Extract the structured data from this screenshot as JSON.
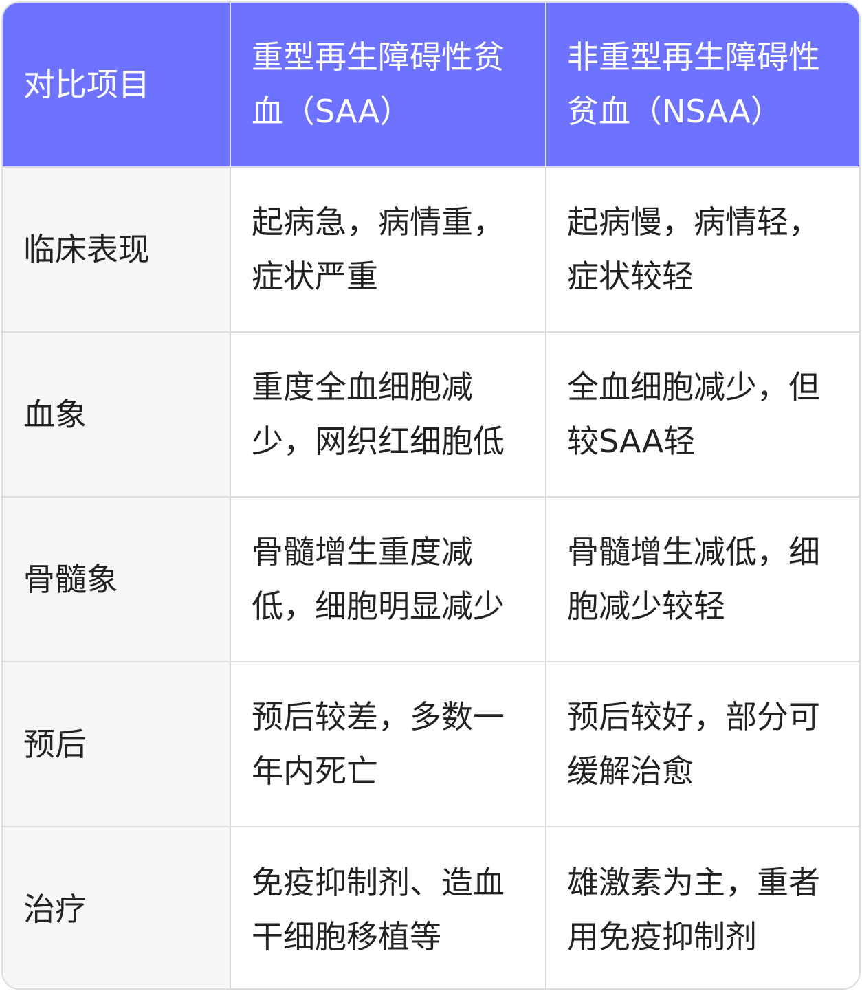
{
  "table": {
    "headers": [
      "对比项目",
      "重型再生障碍性贫血（SAA）",
      "非重型再生障碍性贫血（NSAA）"
    ],
    "rows": [
      [
        "临床表现",
        "起病急，病情重，症状严重",
        "起病慢，病情轻，症状较轻"
      ],
      [
        "血象",
        "重度全血细胞减少，网织红细胞低",
        "全血细胞减少，但较SAA轻"
      ],
      [
        "骨髓象",
        "骨髓增生重度减低，细胞明显减少",
        "骨髓增生减低，细胞减少较轻"
      ],
      [
        "预后",
        "预后较差，多数一年内死亡",
        "预后较好，部分可缓解治愈"
      ],
      [
        "治疗",
        "免疫抑制剂、造血干细胞移植等",
        "雄激素为主，重者用免疫抑制剂"
      ]
    ]
  },
  "colors": {
    "header_bg": "#6e73ff",
    "header_text": "#ffffff",
    "label_bg": "#f6f6f9",
    "border": "#dcdcdc",
    "text": "#222222"
  }
}
